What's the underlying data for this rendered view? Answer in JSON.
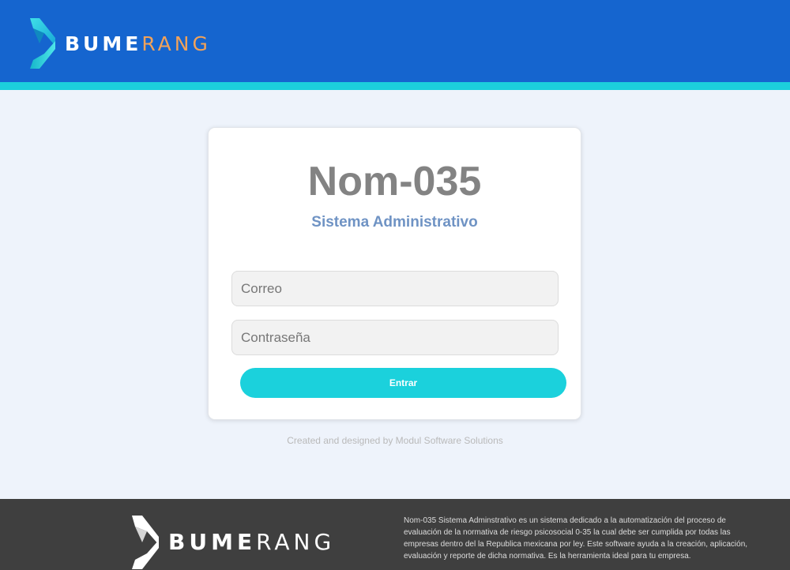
{
  "header": {
    "brand_part1": "BUME",
    "brand_part2": "RANG",
    "logo_icon": "boomerang-chevron-icon",
    "brand_colors": {
      "background": "#1565cf",
      "stripe": "#1ccfdc",
      "accent": "#f1a25a"
    }
  },
  "login": {
    "title": "Nom-035",
    "subtitle": "Sistema Administrativo",
    "email_placeholder": "Correo",
    "email_value": "",
    "password_placeholder": "Contraseña",
    "password_value": "",
    "submit_label": "Entrar",
    "button_color": "#1bd1dc"
  },
  "credit": "Created and designed by Modul Software Solutions",
  "footer": {
    "brand_part1": "BUME",
    "brand_part2": "RANG",
    "description": "Nom-035 Sistema Adminstrativo es un sistema dedicado a la automatización del proceso de evaluación de la normativa de riesgo psicosocial 0-35 la cual debe ser cumplida por todas las empresas dentro del la Republica mexicana por ley. Este software ayuda a la creación, aplicación, evaluación y reporte de dicha normativa. Es la herramienta ideal para tu empresa.",
    "background": "#3f3f3f"
  }
}
